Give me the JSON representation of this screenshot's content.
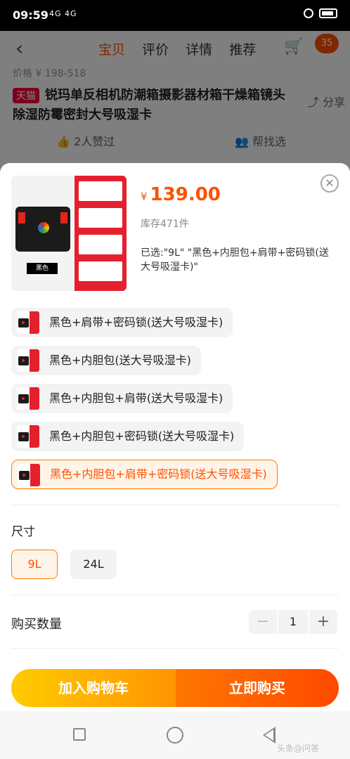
{
  "status": {
    "time": "09:59",
    "signal": "4G 4G"
  },
  "nav": {
    "back_icon": "‹",
    "tabs": [
      "宝贝",
      "评价",
      "详情",
      "推荐"
    ],
    "cart_badge": "35"
  },
  "background": {
    "old_price": "价格 ¥ 198-518",
    "tmall_tag": "天猫",
    "title": "锐玛单反相机防潮箱摄影器材箱干燥箱镜头除湿防霉密封大号吸湿卡",
    "share": "分享",
    "likes": "2人赞过",
    "help": "帮找选"
  },
  "product": {
    "thumb_color_label": "黑色",
    "currency": "¥",
    "price": "139.00",
    "stock": "库存471件",
    "selected_text": "已选:\"9L\" \"黑色+内胆包+肩带+密码锁(送大号吸湿卡)\"",
    "close_icon": "✕"
  },
  "options": [
    {
      "label": "黑色+肩带+密码锁(送大号吸湿卡)",
      "selected": false
    },
    {
      "label": "黑色+内胆包(送大号吸湿卡)",
      "selected": false
    },
    {
      "label": "黑色+内胆包+肩带(送大号吸湿卡)",
      "selected": false
    },
    {
      "label": "黑色+内胆包+密码锁(送大号吸湿卡)",
      "selected": false
    },
    {
      "label": "黑色+内胆包+肩带+密码锁(送大号吸湿卡)",
      "selected": true
    }
  ],
  "size": {
    "title": "尺寸",
    "options": [
      "9L",
      "24L"
    ],
    "selected": "9L"
  },
  "quantity": {
    "title": "购买数量",
    "minus": "−",
    "value": "1",
    "plus": "+"
  },
  "actions": {
    "add_to_cart": "加入购物车",
    "buy_now": "立即购买"
  },
  "watermark": "头条@问答",
  "colors": {
    "accent": "#ff5000",
    "tmall_red": "#ff0036",
    "cart_gradient": [
      "#ffcb00",
      "#ff9402"
    ],
    "buy_gradient": [
      "#ff7700",
      "#ff4900"
    ]
  }
}
